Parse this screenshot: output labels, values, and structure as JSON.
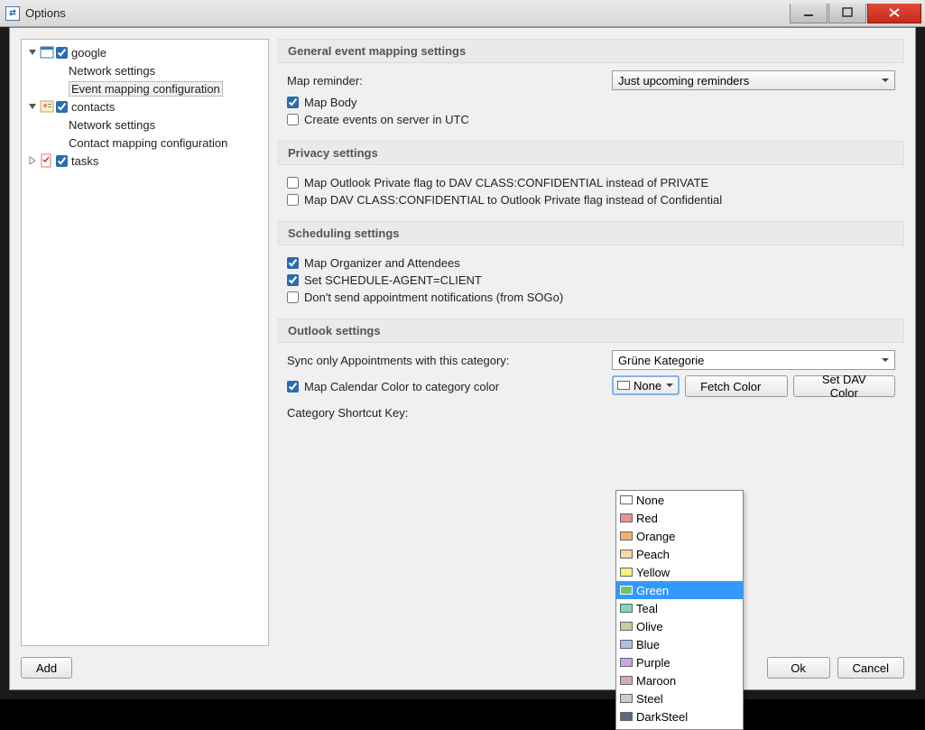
{
  "window": {
    "title": "Options"
  },
  "tree": {
    "google": {
      "label": "google",
      "checked": true,
      "children": [
        "Network settings",
        "Event mapping configuration"
      ]
    },
    "contacts": {
      "label": "contacts",
      "checked": true,
      "children": [
        "Network settings",
        "Contact mapping configuration"
      ]
    },
    "tasks": {
      "label": "tasks",
      "checked": true
    }
  },
  "sections": {
    "general": {
      "title": "General event mapping settings",
      "map_reminder_label": "Map reminder:",
      "map_reminder_value": "Just upcoming reminders",
      "map_body": {
        "label": "Map Body",
        "checked": true
      },
      "create_utc": {
        "label": "Create events on server in UTC",
        "checked": false
      }
    },
    "privacy": {
      "title": "Privacy settings",
      "opt1": {
        "label": "Map Outlook Private flag to DAV CLASS:CONFIDENTIAL instead of PRIVATE",
        "checked": false
      },
      "opt2": {
        "label": "Map DAV CLASS:CONFIDENTIAL to Outlook Private flag instead of Confidential",
        "checked": false
      }
    },
    "scheduling": {
      "title": "Scheduling settings",
      "opt1": {
        "label": "Map Organizer and Attendees",
        "checked": true
      },
      "opt2": {
        "label": "Set SCHEDULE-AGENT=CLIENT",
        "checked": true
      },
      "opt3": {
        "label": "Don't send appointment notifications (from SOGo)",
        "checked": false
      }
    },
    "outlook": {
      "title": "Outlook settings",
      "sync_label": "Sync only Appointments with this category:",
      "sync_value": "Grüne Kategorie",
      "map_color": {
        "label": "Map Calendar Color to category color",
        "checked": true
      },
      "color_value": "None",
      "fetch_label": "Fetch Color",
      "set_label": "Set DAV Color",
      "shortcut_label": "Category Shortcut Key:"
    }
  },
  "colors": [
    {
      "name": "None",
      "hex": "#ffffff"
    },
    {
      "name": "Red",
      "hex": "#e89494"
    },
    {
      "name": "Orange",
      "hex": "#f2b270"
    },
    {
      "name": "Peach",
      "hex": "#f5d9a6"
    },
    {
      "name": "Yellow",
      "hex": "#f9f27f"
    },
    {
      "name": "Green",
      "hex": "#6fc46f"
    },
    {
      "name": "Teal",
      "hex": "#7fd6c1"
    },
    {
      "name": "Olive",
      "hex": "#c9cc9a"
    },
    {
      "name": "Blue",
      "hex": "#a6c1ec"
    },
    {
      "name": "Purple",
      "hex": "#c8a6e8"
    },
    {
      "name": "Maroon",
      "hex": "#d9a6c1"
    },
    {
      "name": "Steel",
      "hex": "#c8cdd4"
    },
    {
      "name": "DarkSteel",
      "hex": "#5f6a78"
    }
  ],
  "selected_color": "Green",
  "buttons": {
    "add": "Add",
    "ok": "Ok",
    "cancel": "Cancel"
  }
}
